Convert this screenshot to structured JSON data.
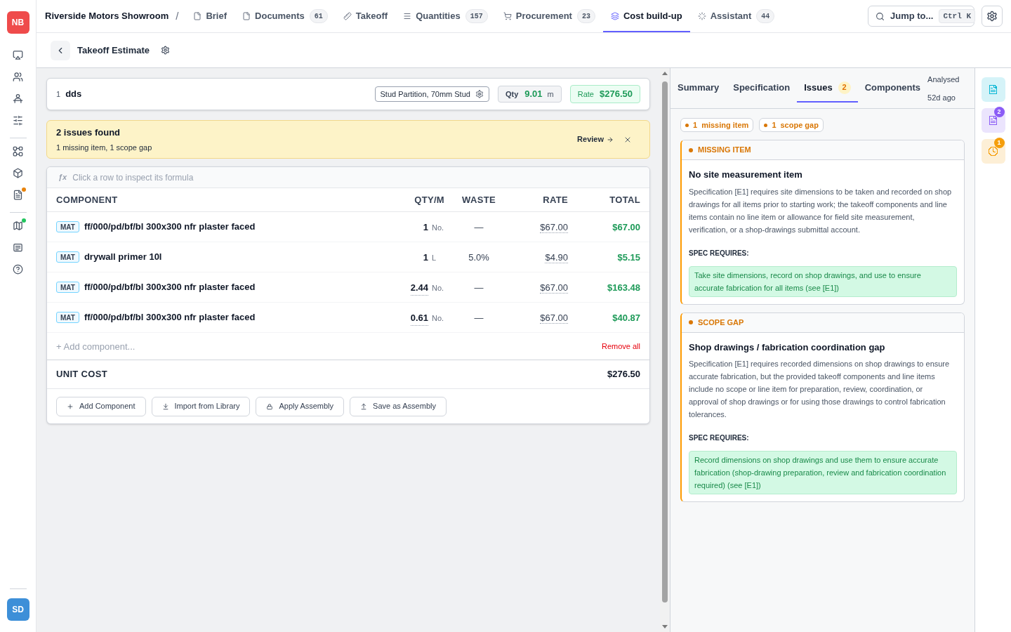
{
  "sidebar": {
    "logo": "NB",
    "groups": [
      {
        "items": [
          {
            "notification": false
          },
          {
            "notification": false
          },
          {
            "notification": false
          },
          {
            "notification": false
          }
        ]
      },
      {
        "items": [
          {
            "notification": false
          },
          {
            "notification": false
          },
          {
            "notification": true,
            "color": "#e8830c"
          }
        ]
      },
      {
        "items": [
          {
            "notification": true,
            "color": "#22c55e"
          },
          {
            "notification": false
          },
          {
            "notification": false
          }
        ]
      }
    ],
    "user": "SD"
  },
  "top_bar": {
    "project": "Riverside Motors Showroom",
    "separator": "/",
    "tabs": [
      {
        "label": "Brief",
        "selected": false
      },
      {
        "label": "Documents",
        "count": "61",
        "selected": false
      },
      {
        "label": "Takeoff",
        "selected": false
      },
      {
        "label": "Quantities",
        "count": "157",
        "selected": false
      },
      {
        "label": "Procurement",
        "count": "23",
        "selected": false
      },
      {
        "label": "Cost build-up",
        "selected": true
      },
      {
        "label": "Assistant",
        "count": "44",
        "selected": false
      }
    ],
    "search": {
      "label": "Jump to...",
      "shortcut": "Ctrl K"
    }
  },
  "sub_header": {
    "title": "Takeoff Estimate"
  },
  "item": {
    "number": "1",
    "name": "dds",
    "assembly": "Stud Partition, 70mm Stud",
    "qty_label": "Qty",
    "qty": "9.01",
    "qty_unit": "m",
    "rate_label": "Rate",
    "rate": "$276.50"
  },
  "issues_banner": {
    "title": "2 issues found",
    "summary": "1 missing item, 1 scope gap",
    "action": "Review"
  },
  "components": {
    "formula_symbol": "ƒx",
    "formula_hint": "Click a row to inspect its formula",
    "columns": [
      "COMPONENT",
      "QTY/M",
      "WASTE",
      "RATE",
      "TOTAL"
    ],
    "rows": [
      {
        "type": "MAT",
        "name": "ff/000/pd/bf/bl 300x300 nfr plaster faced",
        "qty": "1",
        "unit": "No.",
        "formula": false,
        "waste": "—",
        "rate": "$67.00",
        "total": "$67.00"
      },
      {
        "type": "MAT",
        "name": "drywall primer 10l",
        "qty": "1",
        "unit": "L",
        "formula": false,
        "waste": "5.0%",
        "rate": "$4.90",
        "total": "$5.15"
      },
      {
        "type": "MAT",
        "name": "ff/000/pd/bf/bl 300x300 nfr plaster faced",
        "qty": "2.44",
        "unit": "No.",
        "formula": true,
        "waste": "—",
        "rate": "$67.00",
        "total": "$163.48"
      },
      {
        "type": "MAT",
        "name": "ff/000/pd/bf/bl 300x300 nfr plaster faced",
        "qty": "0.61",
        "unit": "No.",
        "formula": true,
        "waste": "—",
        "rate": "$67.00",
        "total": "$40.87"
      }
    ],
    "add_component": {
      "placeholder": "+ Add component..."
    },
    "remove_all": "Remove all",
    "unit_cost": {
      "label": "UNIT COST",
      "value": "$276.50"
    },
    "actions": [
      "Add Component",
      "Import from Library",
      "Apply Assembly",
      "Save as Assembly"
    ]
  },
  "analysis": {
    "tabs": [
      {
        "label": "Summary",
        "selected": false
      },
      {
        "label": "Specification",
        "selected": false
      },
      {
        "label": "Issues",
        "count": "2",
        "selected": true
      },
      {
        "label": "Components",
        "selected": false
      }
    ],
    "analysed": "Analysed 52d ago",
    "filters": [
      {
        "count": "1",
        "label": "missing item"
      },
      {
        "count": "1",
        "label": "scope gap"
      }
    ],
    "issues": [
      {
        "category": "MISSING ITEM",
        "title": "No site measurement item",
        "description": "Specification [E1] requires site dimensions to be taken and recorded on shop drawings for all items prior to starting work; the takeoff components and line items contain no line item or allowance for field site measurement, verification, or a shop-drawings submittal account.",
        "requirement_label": "SPEC REQUIRES:",
        "requirement": "Take site dimensions, record on shop drawings, and use to ensure accurate fabrication for all items (see [E1])"
      },
      {
        "category": "SCOPE GAP",
        "title": "Shop drawings / fabrication coordination gap",
        "description": "Specification [E1] requires recorded dimensions on shop drawings to ensure accurate fabrication, but the provided takeoff components and line items include no scope or line item for preparation, review, coordination, or approval of shop drawings or for using those drawings to control fabrication tolerances.",
        "requirement_label": "SPEC REQUIRES:",
        "requirement": "Record dimensions on shop drawings and use them to ensure accurate fabrication (shop-drawing preparation, review and fabrication coordination required) (see [E1])"
      }
    ]
  },
  "rail": [
    {
      "color": "#06b6d4"
    },
    {
      "color": "#8b5cf6",
      "count": "2"
    },
    {
      "color": "#f59e0b",
      "count": "1"
    }
  ]
}
